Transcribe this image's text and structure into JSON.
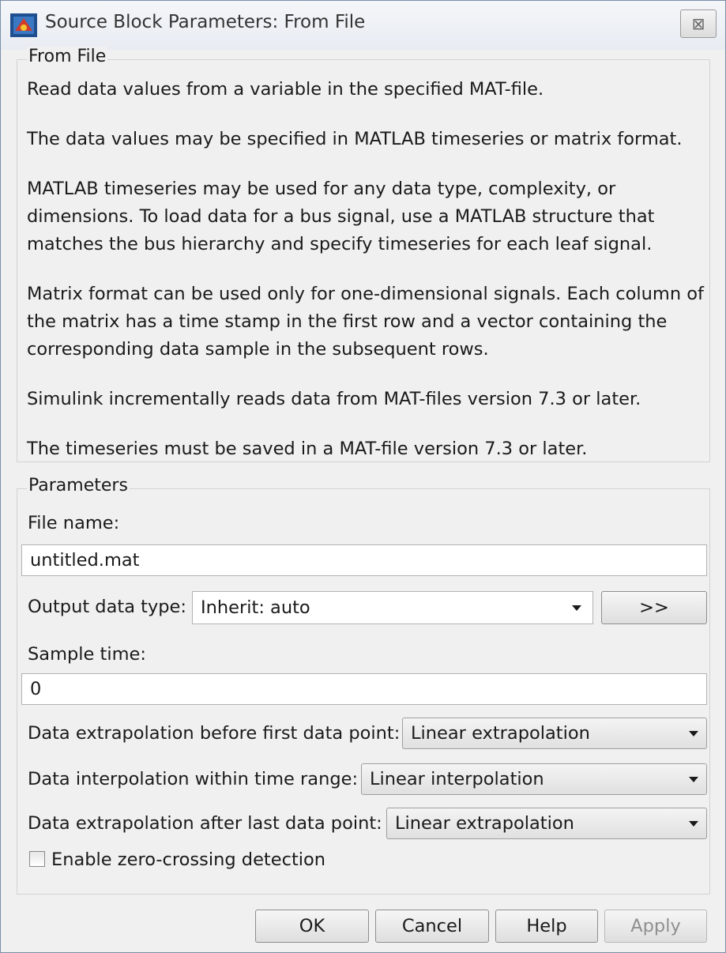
{
  "window": {
    "title": "Source Block Parameters: From File",
    "icon": "simulink-block-icon",
    "close_icon": "close-icon",
    "close_glyph": "⊠"
  },
  "description_group": {
    "label": "From File",
    "paragraphs": [
      "Read data values from a variable in the specified MAT-file.",
      "The data values may be specified in MATLAB timeseries or matrix format.",
      "MATLAB timeseries may be used for any data type, complexity, or dimensions. To load data for a bus signal, use a MATLAB structure that matches the bus hierarchy and specify timeseries for each leaf signal.",
      "Matrix format can be used only for one-dimensional signals. Each column of the matrix has a time stamp in the first row and a vector containing the corresponding data sample in the subsequent rows.",
      "Simulink incrementally reads data from MAT-files version 7.3 or later.",
      "The timeseries must be saved in a MAT-file version 7.3 or later."
    ]
  },
  "parameters": {
    "label": "Parameters",
    "file_name_label": "File name:",
    "file_name_value": "untitled.mat",
    "output_type_label": "Output data type:",
    "output_type_value": "Inherit: auto",
    "expand_button": ">>",
    "sample_time_label": "Sample time:",
    "sample_time_value": "0",
    "extrap_before_label": "Data extrapolation before first data point:",
    "extrap_before_value": "Linear extrapolation",
    "interp_label": "Data interpolation within time range:",
    "interp_value": "Linear interpolation",
    "extrap_after_label": "Data extrapolation after last data point:",
    "extrap_after_value": "Linear extrapolation",
    "zero_crossing_label": "Enable zero-crossing detection",
    "zero_crossing_checked": false
  },
  "buttons": {
    "ok": "OK",
    "cancel": "Cancel",
    "help": "Help",
    "apply": "Apply"
  }
}
